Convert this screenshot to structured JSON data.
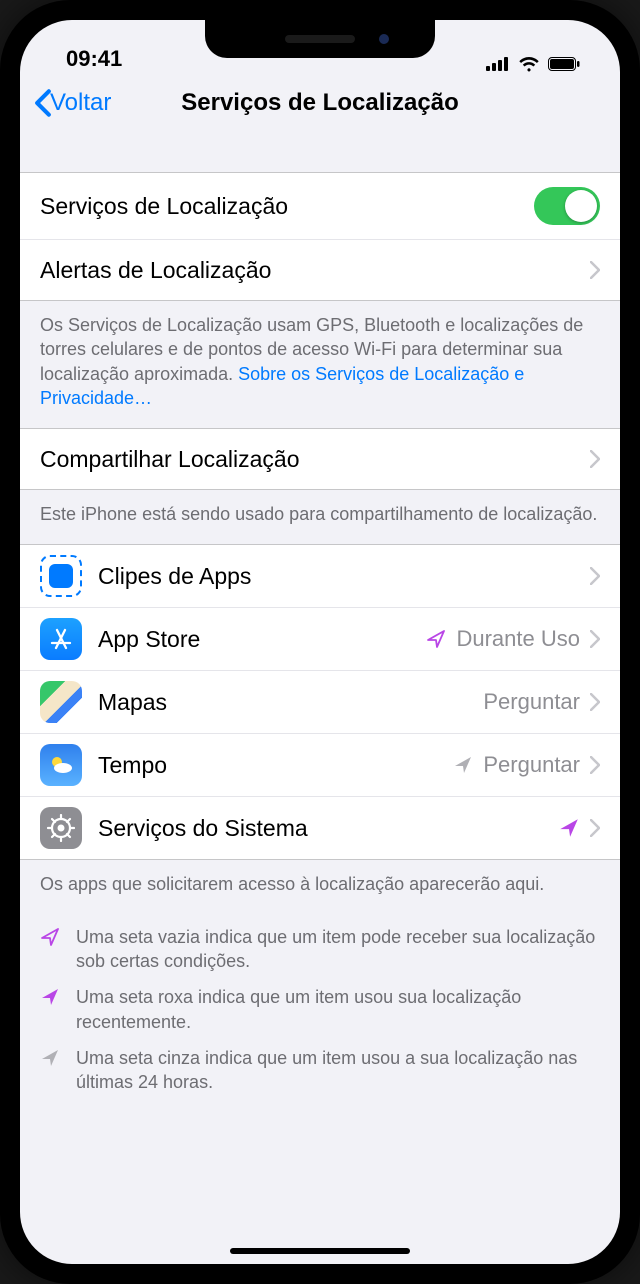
{
  "status": {
    "time": "09:41"
  },
  "nav": {
    "back": "Voltar",
    "title": "Serviços de Localização"
  },
  "section1": {
    "locationServices": "Serviços de Localização",
    "locationAlerts": "Alertas de Localização",
    "footer": "Os Serviços de Localização usam GPS, Bluetooth e localizações de torres celulares e de pontos de acesso Wi-Fi para determinar sua localização aproximada.",
    "footerLink": "Sobre os Serviços de Localização e Privacidade…"
  },
  "section2": {
    "shareLocation": "Compartilhar Localização",
    "footer": "Este iPhone está sendo usado para compartilhamento de localização."
  },
  "apps": {
    "clips": {
      "label": "Clipes de Apps",
      "value": ""
    },
    "store": {
      "label": "App Store",
      "value": "Durante Uso"
    },
    "maps": {
      "label": "Mapas",
      "value": "Perguntar"
    },
    "weather": {
      "label": "Tempo",
      "value": "Perguntar"
    },
    "system": {
      "label": "Serviços do Sistema",
      "value": ""
    },
    "footer": "Os apps que solicitarem acesso à localização aparecerão aqui."
  },
  "legend": {
    "hollow": "Uma seta vazia indica que um item pode receber sua localização sob certas condições.",
    "purple": "Uma seta roxa indica que um item usou sua localização recentemente.",
    "gray": "Uma seta cinza indica que um item usou a sua localização nas últimas 24 horas."
  }
}
